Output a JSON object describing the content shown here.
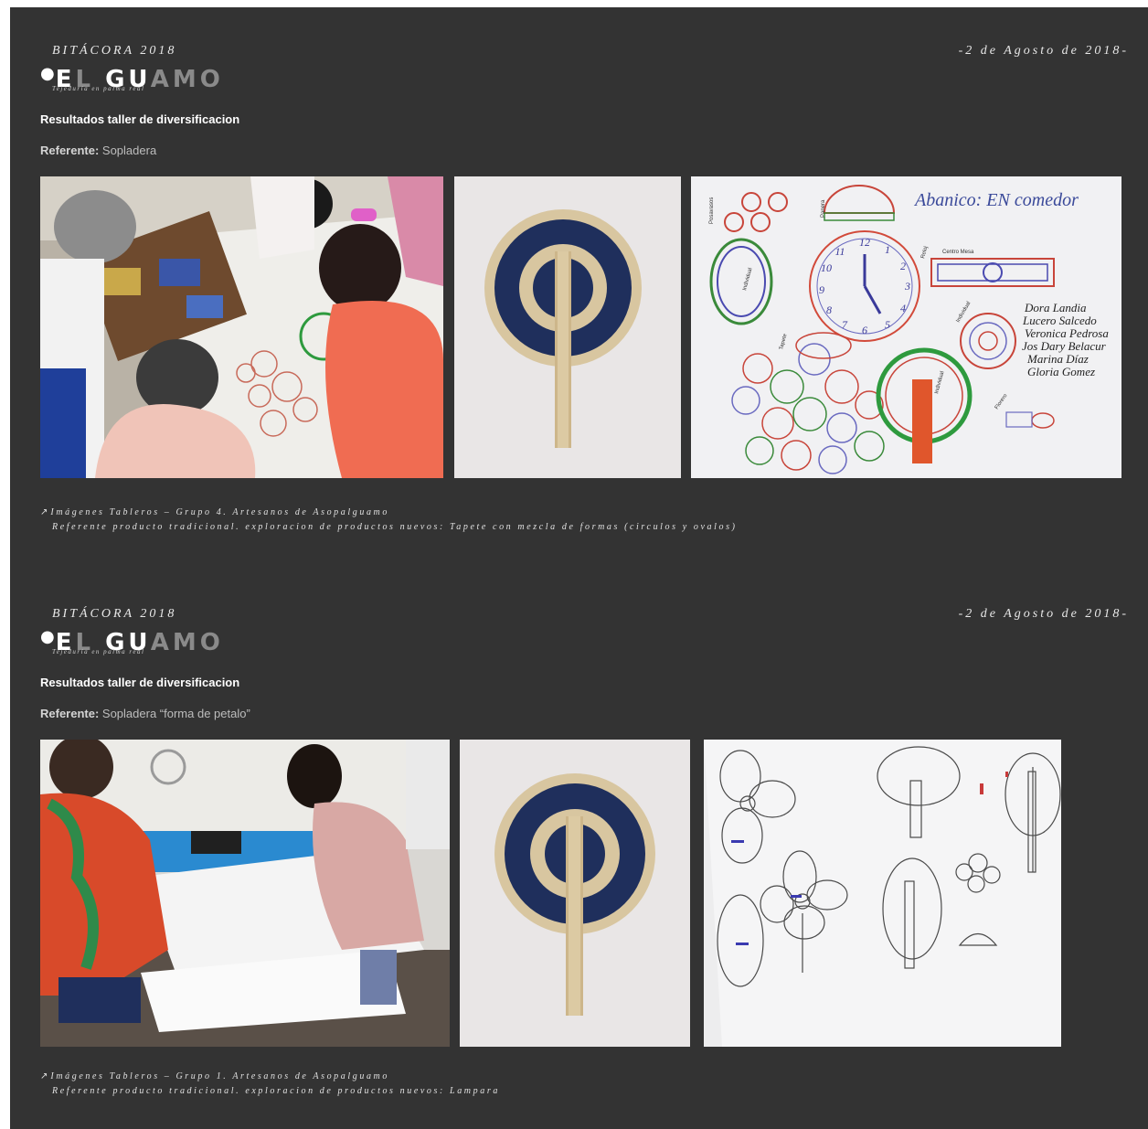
{
  "sections": [
    {
      "header": {
        "logbook": "BITÁCORA 2018",
        "logo_first": "EL",
        "logo_first_white": "E",
        "logo_first_grey": "L",
        "logo_second_white": "GU",
        "logo_second_grey": "AMO",
        "tagline": "Tejeduría en palma real",
        "date": "-2 de Agosto de 2018-"
      },
      "title": "Resultados taller de diversificacion",
      "referente_label": "Referente:",
      "referente_value": " Sopladera",
      "photo_board_text": {
        "heading": "Abanico: EN comedor",
        "names": [
          "Dora Landia",
          "Lucero Salcedo",
          "Veronica Pedrosa",
          "Jos Dary Belacur",
          "Marina Díaz",
          "Gloria Gomez"
        ],
        "labels": [
          "Posavasos",
          "Individual",
          "Individual",
          "Panera",
          "Centro Mesa",
          "Individual",
          "Reloj",
          "Tapete",
          "Florero"
        ],
        "clock_numbers": [
          "12",
          "1",
          "2",
          "3",
          "4",
          "5",
          "6",
          "7",
          "8",
          "9",
          "10",
          "11"
        ]
      },
      "caption_line1": "Imágenes Tableros – Grupo 4. Artesanos de Asopalguamo",
      "caption_line2": "Referente producto tradicional. exploracion de productos nuevos: Tapete con mezcla de formas (circulos y ovalos)"
    },
    {
      "header": {
        "logbook": "BITÁCORA 2018",
        "logo_first_white": "E",
        "logo_first_grey": "L",
        "logo_second_white": "GU",
        "logo_second_grey": "AMO",
        "tagline": "Tejeduría en palma real",
        "date": "-2 de Agosto de 2018-"
      },
      "title": "Resultados taller de diversificacion",
      "referente_label": "Referente:",
      "referente_value": " Sopladera “forma de petalo”",
      "caption_line1": "Imágenes Tableros – Grupo 1. Artesanos de Asopalguamo",
      "caption_line2": "Referente producto tradicional. exploracion de productos nuevos: Lampara"
    }
  ],
  "icons": {
    "caption_arrow": "north-east-arrow-icon"
  },
  "colors": {
    "background": "#333333",
    "fan_blue": "#1f2f5c",
    "straw": "#d8c6a0"
  }
}
